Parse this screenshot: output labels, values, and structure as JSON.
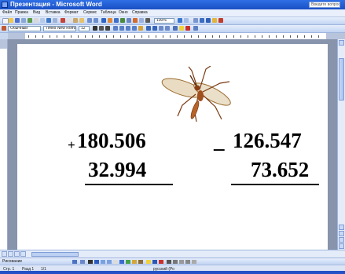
{
  "window": {
    "title": "Презентация - Microsoft Word",
    "help_box": "Введите вопрос"
  },
  "menu": [
    "Файл",
    "Правка",
    "Вид",
    "Вставка",
    "Формат",
    "Сервис",
    "Таблица",
    "Окно",
    "Справка"
  ],
  "toolbar": {
    "style_combo": "Обычный",
    "font_combo": "Times New Roman",
    "size_combo": "12"
  },
  "drawbar": {
    "label": "Рисование"
  },
  "status": {
    "page": "Стр. 1",
    "section": "Разд 1",
    "pages": "1/1",
    "language": "русский (Ро"
  },
  "document": {
    "op1": "+",
    "num1": "180.506",
    "num2": "32.994",
    "op2": "_",
    "num3": "126.547",
    "num4": "73.652"
  },
  "colors": {
    "title_bar": "#1a4fc4",
    "page": "#ffffff",
    "workspace": "#8894ac"
  }
}
